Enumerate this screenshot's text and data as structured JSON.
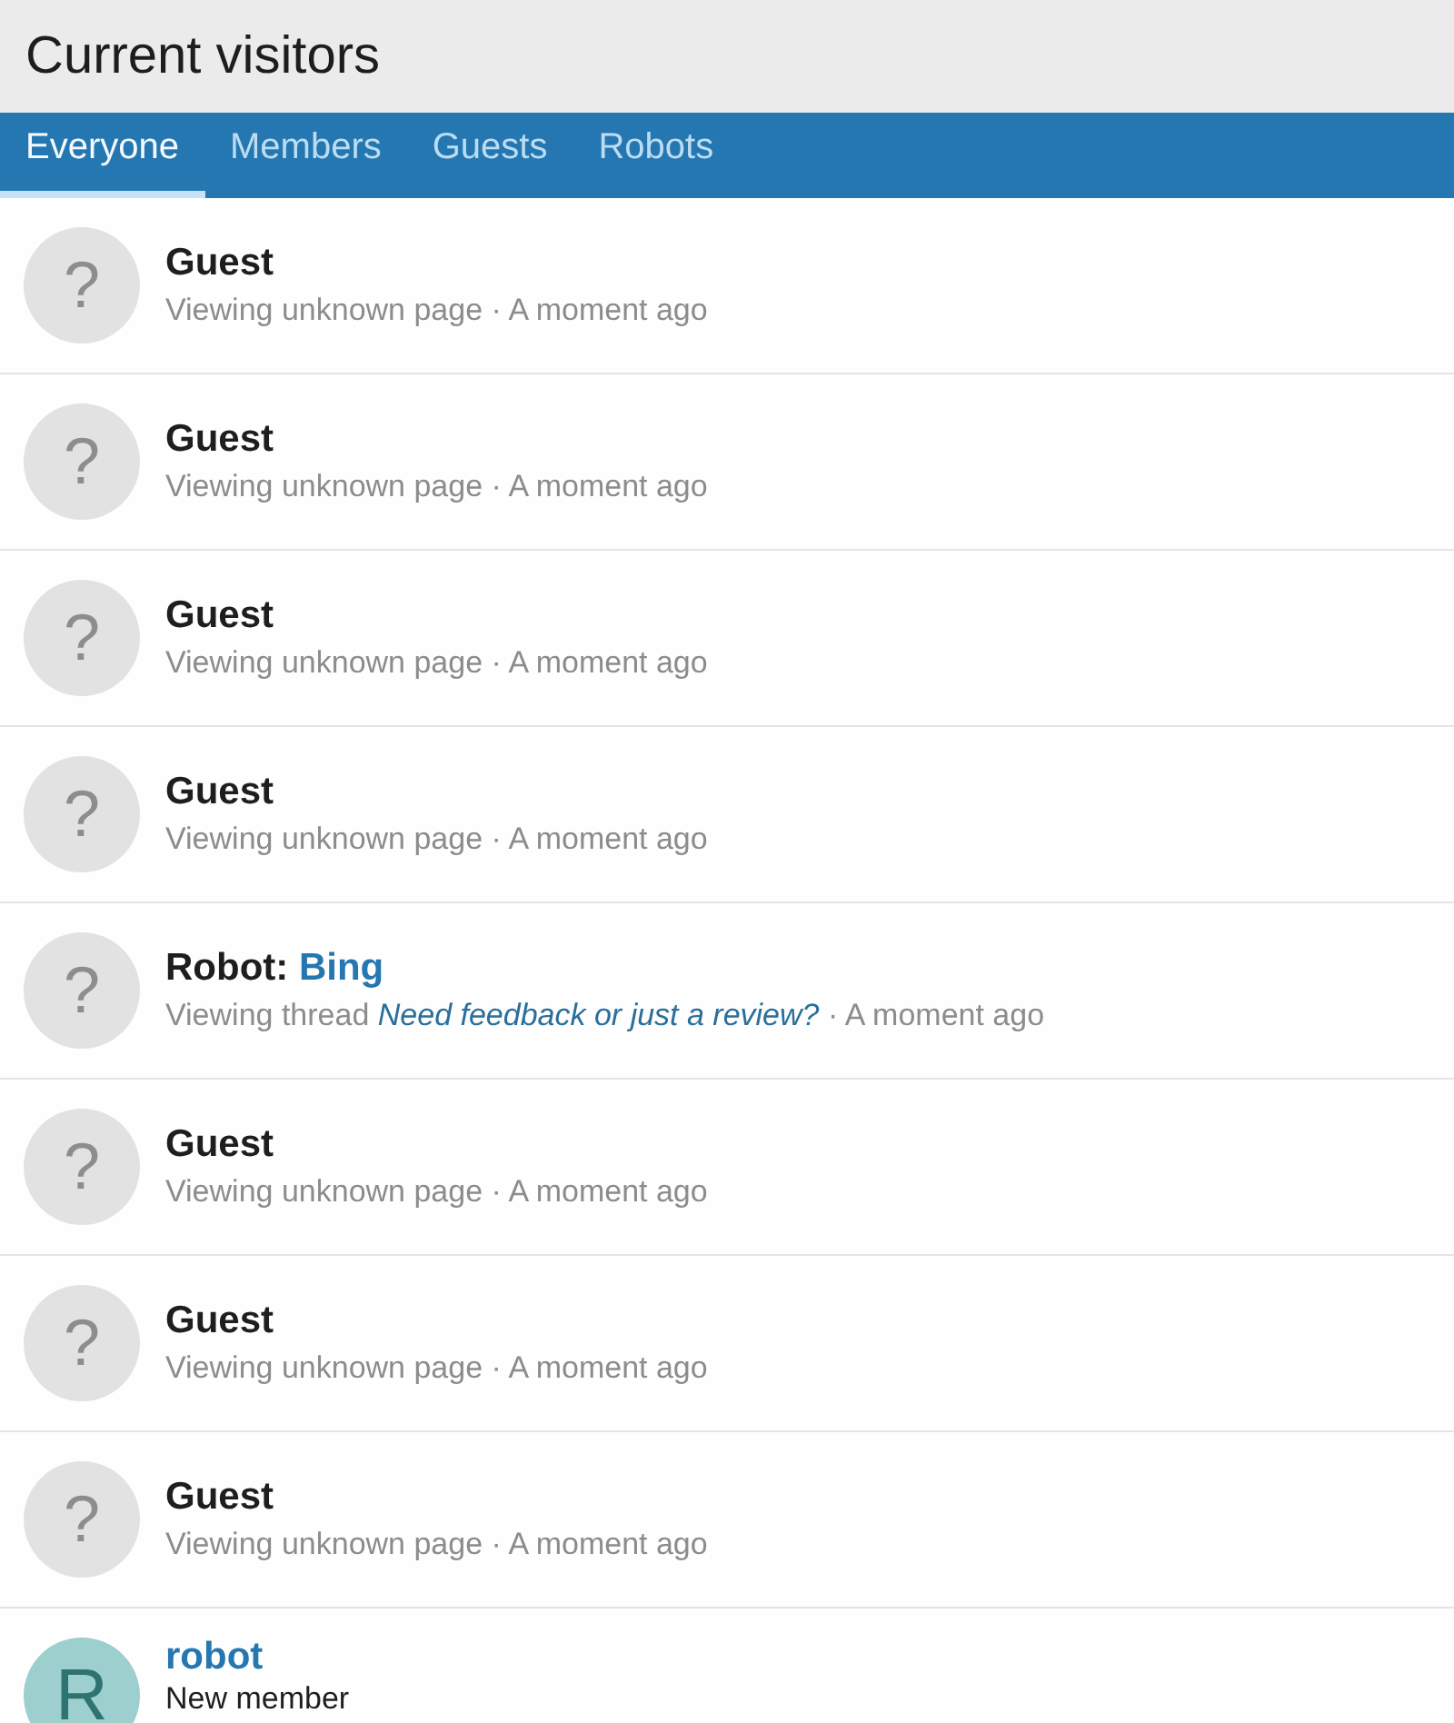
{
  "header": {
    "title": "Current visitors"
  },
  "tabs": [
    {
      "label": "Everyone",
      "selected": true
    },
    {
      "label": "Members",
      "selected": false
    },
    {
      "label": "Guests",
      "selected": false
    },
    {
      "label": "Robots",
      "selected": false
    }
  ],
  "visitors": [
    {
      "kind": "guest",
      "avatar": "?",
      "name": "Guest",
      "status": "Viewing unknown page · A moment ago"
    },
    {
      "kind": "guest",
      "avatar": "?",
      "name": "Guest",
      "status": "Viewing unknown page · A moment ago"
    },
    {
      "kind": "guest",
      "avatar": "?",
      "name": "Guest",
      "status": "Viewing unknown page · A moment ago"
    },
    {
      "kind": "guest",
      "avatar": "?",
      "name": "Guest",
      "status": "Viewing unknown page · A moment ago"
    },
    {
      "kind": "robot",
      "avatar": "?",
      "label": "Robot:",
      "name": "Bing",
      "status": "Viewing thread",
      "link": "Need feedback or just a review?",
      "suffix": "· A moment ago"
    },
    {
      "kind": "guest",
      "avatar": "?",
      "name": "Guest",
      "status": "Viewing unknown page · A moment ago"
    },
    {
      "kind": "guest",
      "avatar": "?",
      "name": "Guest",
      "status": "Viewing unknown page · A moment ago"
    },
    {
      "kind": "guest",
      "avatar": "?",
      "name": "Guest",
      "status": "Viewing unknown page · A moment ago"
    },
    {
      "kind": "member",
      "avatar": "R",
      "name": "robot",
      "status": "New member"
    }
  ]
}
